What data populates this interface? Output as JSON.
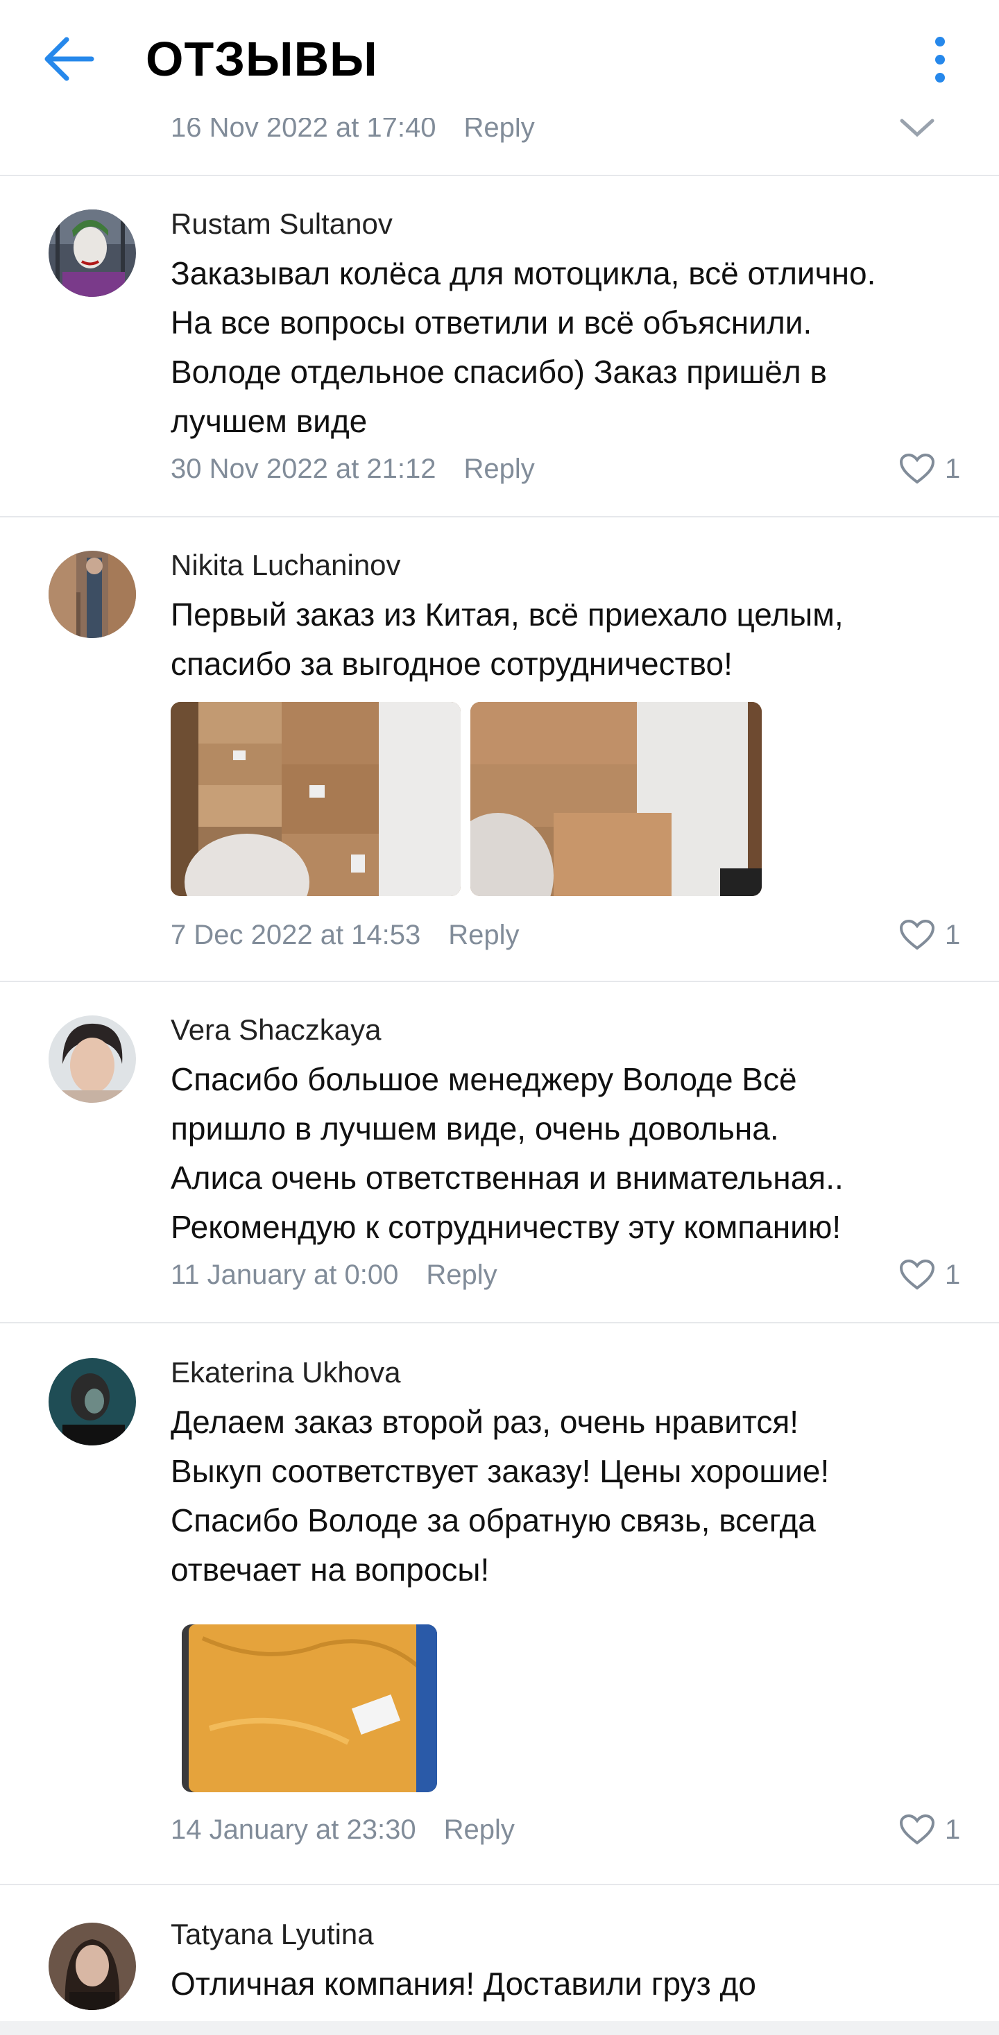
{
  "header": {
    "title": "ОТЗЫВЫ"
  },
  "partial_comment": {
    "date": "16 Nov 2022 at 17:40",
    "reply": "Reply"
  },
  "comments": [
    {
      "author": "Rustam Sultanov",
      "lines": [
        "Заказывал колёса для мотоцикла, всё отлично.",
        "На все вопросы ответили и всё объяснили.",
        "Володе отдельное спасибо) Заказ пришёл в",
        "лучшем виде"
      ],
      "date": "30 Nov 2022 at 21:12",
      "reply": "Reply",
      "likes": "1"
    },
    {
      "author": "Nikita Luchaninov",
      "lines": [
        "Первый заказ из Китая, всё приехало целым,",
        "спасибо за выгодное сотрудничество!"
      ],
      "date": "7 Dec 2022 at 14:53",
      "reply": "Reply",
      "likes": "1"
    },
    {
      "author": "Vera Shaczkaya",
      "lines": [
        "Спасибо большое менеджеру Володе Всё",
        "пришло в лучшем виде, очень довольна.",
        "Алиса очень ответственная и внимательная..",
        "Рекомендую к сотрудничеству эту компанию!"
      ],
      "date": "11 January at 0:00",
      "reply": "Reply",
      "likes": "1"
    },
    {
      "author": "Ekaterina Ukhova",
      "lines": [
        "Делаем заказ второй раз, очень нравится!",
        "Выкуп соответствует заказу! Цены хорошие!",
        "Спасибо Володе за обратную связь, всегда",
        "отвечает на вопросы!"
      ],
      "date": "14 January at 23:30",
      "reply": "Reply",
      "likes": "1"
    },
    {
      "author": "Tatyana Lyutina",
      "lines": [
        "Отличная компания! Доставили груз до"
      ]
    }
  ],
  "colors": {
    "accent": "#2688eb",
    "meta": "#818c99",
    "divider": "#e6e8eb"
  },
  "icons": {
    "back": "arrow-left-icon",
    "more": "more-vertical-icon",
    "like": "heart-icon",
    "collapse": "chevron-down-icon"
  }
}
